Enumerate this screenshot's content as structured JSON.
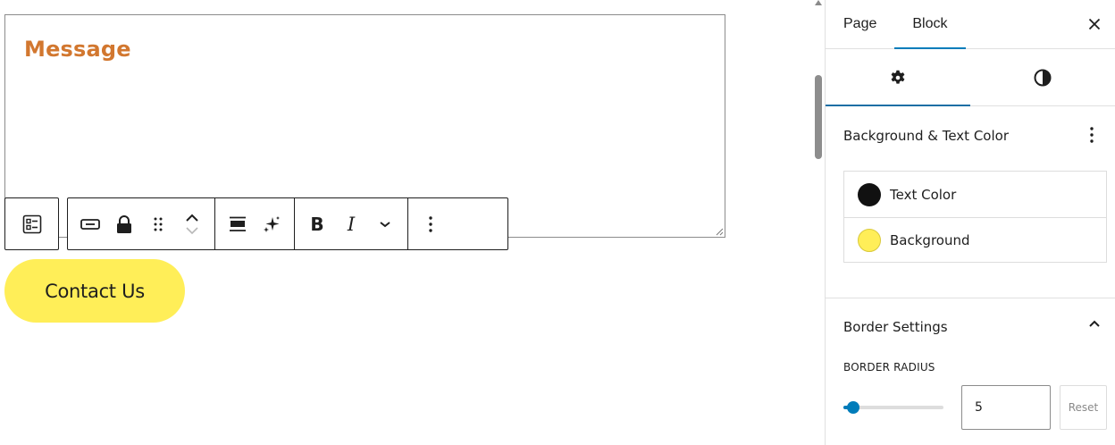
{
  "editor": {
    "textarea_placeholder": "Message",
    "button_label": "Contact Us"
  },
  "toolbar": {
    "bold_label": "B",
    "italic_label": "I"
  },
  "sidebar": {
    "tabs": [
      {
        "label": "Page",
        "active": false
      },
      {
        "label": "Block",
        "active": true
      }
    ],
    "subtabs": [
      {
        "icon": "gear-icon",
        "active": true
      },
      {
        "icon": "contrast-icon",
        "active": false
      }
    ],
    "color_panel": {
      "title": "Background & Text Color",
      "items": [
        {
          "label": "Text Color",
          "swatch": "#111111"
        },
        {
          "label": "Background",
          "swatch": "#ffee58"
        }
      ]
    },
    "border_panel": {
      "title": "Border Settings",
      "radius_label": "BORDER RADIUS",
      "radius_value": "5",
      "radius_fraction": 0.1,
      "reset_label": "Reset"
    }
  },
  "colors": {
    "accent": "#007cba",
    "placeholder": "#d2772f",
    "button_bg": "#ffee58"
  }
}
